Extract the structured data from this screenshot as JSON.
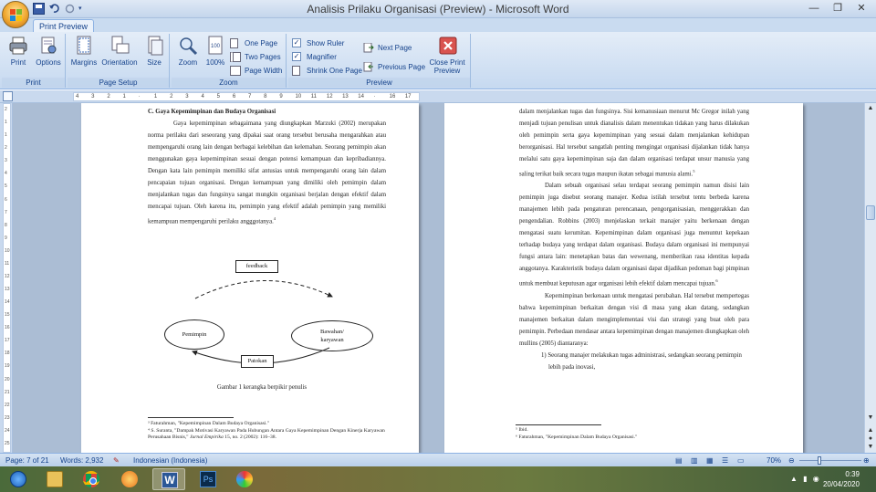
{
  "window": {
    "title": "Analisis Prilaku Organisasi (Preview) - Microsoft Word",
    "controls": {
      "minimize": "—",
      "restore": "❐",
      "close": "✕"
    }
  },
  "tabs": {
    "print_preview": "Print Preview"
  },
  "ribbon": {
    "print_group": {
      "label": "Print",
      "print": "Print",
      "options": "Options"
    },
    "page_setup_group": {
      "label": "Page Setup",
      "margins": "Margins",
      "orientation": "Orientation",
      "size": "Size"
    },
    "zoom_group": {
      "label": "Zoom",
      "zoom": "Zoom",
      "hundred": "100%",
      "one_page": "One Page",
      "two_pages": "Two Pages",
      "page_width": "Page Width"
    },
    "preview_group": {
      "label": "Preview",
      "show_ruler": "Show Ruler",
      "magnifier": "Magnifier",
      "shrink_one_page": "Shrink One Page",
      "next_page": "Next Page",
      "previous_page": "Previous Page",
      "close_print_preview": "Close Print Preview",
      "show_ruler_checked": true,
      "magnifier_checked": true,
      "shrink_checked": false
    }
  },
  "ruler": {
    "ticks": [
      "4",
      "3",
      "2",
      "1",
      "",
      "1",
      "2",
      "3",
      "4",
      "5",
      "6",
      "7",
      "8",
      "9",
      "10",
      "11",
      "12",
      "13",
      "14",
      "",
      "16",
      "17"
    ]
  },
  "vruler": {
    "ticks": [
      "2",
      "1",
      "1",
      "2",
      "3",
      "4",
      "5",
      "6",
      "7",
      "8",
      "9",
      "10",
      "11",
      "12",
      "13",
      "14",
      "15",
      "16",
      "17",
      "18",
      "19",
      "20",
      "21",
      "22",
      "23",
      "24",
      "25"
    ]
  },
  "left_page": {
    "heading": "C. Gaya Kepemimpinan dan Budaya Organisasi",
    "para1": "Gaya kepemimpinan sebagaimana yang diungkapkan Marzuki (2002) merupakan norma perilaku dari seseorang yang dipakai saat orang tersebut berusaha mengarahkan atau mempengaruhi orang lain dengan berbagai kelebihan dan kelemahan. Seorang pemimpin akan menggunakan gaya kepemimpinan sesuai dengan potensi kemampuan dan kepribadiannya. Dengan kata lain pemimpin memiliki sifat antusias untuk mempengaruhi orang lain dalam pencapaian tujuan organisasi. Dengan kemampuan yang dimiliki oleh pemimpin dalam menjalankan tugas dan fungsinya sangat mungkin organisasi berjalan dengan efektif dalam mencapai tujuan. Oleh karena itu, pemimpin yang efektif adalah pemimpin yang memiliki kemampuan mempengaruhi perilaku angggotanya.",
    "para1_sup": "4",
    "diagram": {
      "feedback": "feedback",
      "pemimpin": "Pemimpin",
      "bawahan": "Bawahan/ karyawan",
      "patokan": "Patokan"
    },
    "caption": "Gambar 1 kerangka berpikir penulis",
    "footnote1": "³ Faturahman, \"Kepemimpinan Dalam Budaya Organisasi.\"",
    "footnote2_a": "⁴ S. Suranta, \"Dampak Motivasi Karyawan Pada Hubungan Antara Gaya Kepemimpinan Dengan Kinerja Karyawan Perusahaan Bisnis,\" ",
    "footnote2_journal": "Jurnal Empirika",
    "footnote2_b": " 15, no. 2 (2002): 116–38."
  },
  "right_page": {
    "para1": "dalam menjalankan tugas dan fungsinya. Sisi kemanusiaan menurut Mc Gregor inilah yang menjadi tujuan penulisan untuk dianalisis dalam menentukan tidakan yang harus dilakukan oleh pemimpin serta gaya kepemimpinan yang sesuai dalam menjalankan kehidupan berorganisasi. Hal tersebut sangatlah penting mengingat organisasi dijalankan tidak hanya melalui satu gaya kepemimpinan saja dan dalam organisasi terdapat unsur manusia yang saling terikat baik secara tugas maupun ikatan sebagai manusia alami.",
    "para1_sup": "5",
    "para2": "Dalam sebuah organisasi selau terdapat seorang pemimpin namun disisi lain pemimpin juga disebut seorang manajer. Kedua istilah tersebut tentu berbeda karena manajemen lebih pada pengaturan perencanaan, pengorganisasian, menggerakkan dan pengendalian. Robbins (2003) menjelaskan terkait manajer yaitu berkenaan dengan mengatasi suatu kerumitan. Kepemimpinan dalam organisasi juga menuntut kepekaan terhadap budaya yang terdapat dalam organisasi. Budaya dalam organisasi ini mempunyai fungsi antara lain: menetapkan batas dan wewenang, memberikan rasa identitas kepada anggotanya. Karakteristik budaya dalam organisasi dapat dijadikan pedoman bagi pimpinan untuk membuat keputusan agar organisasi lebih efektif dalam mencapai tujuan.",
    "para2_sup": "6",
    "para3": "Kepemimpinan berkenaan untuk mengatasi perubahan. Hal tersebut mempertegas bahwa kepemimpinan berkaitan dengan visi di masa yang akan datang, sedangkan manajemen berkaitan dalam mengimplementasi visi dan strategi yang buat oleh para pemimpin. Perbedaan mendasar antara kepemimpinan dengan manajemen diungkapkan oleh mullins (2005) diantaranya:",
    "list1": "1) Seorang manajer melakukan tugas administrasi, sedangkan seorang pemimpin lebih pada inovasi,",
    "footnote1": "⁵ Ibid.",
    "footnote2": "⁶ Faturahman, \"Kepemimpinan Dalam Budaya Organisasi.\""
  },
  "status": {
    "page": "Page: 7 of 21",
    "words": "Words: 2,932",
    "language": "Indonesian (Indonesia)",
    "zoom": "70%"
  },
  "taskbar": {
    "time": "0:39",
    "date": "20/04/2020"
  }
}
